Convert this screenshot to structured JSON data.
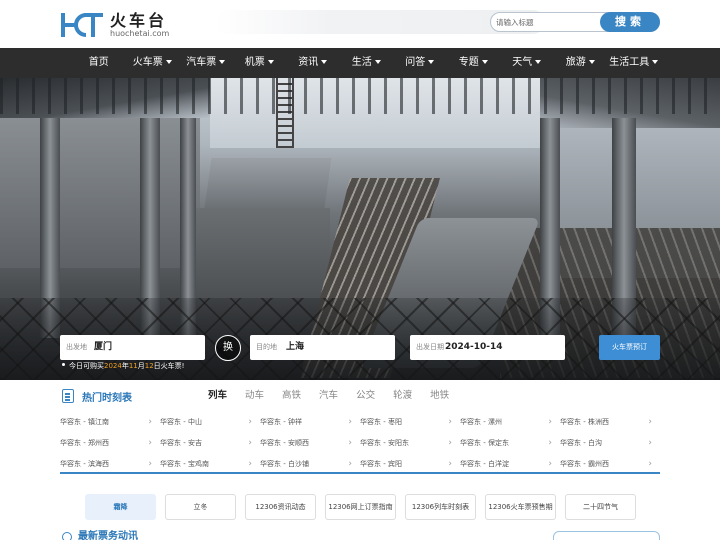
{
  "brand": {
    "logo_letters": "HCT",
    "name": "火车台",
    "domain": "huochetai.com",
    "accent": "#3a86c4"
  },
  "search": {
    "placeholder": "请输入标题",
    "button_label": "搜索"
  },
  "nav": {
    "items": [
      {
        "label": "首页",
        "dropdown": false
      },
      {
        "label": "火车票",
        "dropdown": true
      },
      {
        "label": "汽车票",
        "dropdown": true
      },
      {
        "label": "机票",
        "dropdown": true
      },
      {
        "label": "资讯",
        "dropdown": true
      },
      {
        "label": "生活",
        "dropdown": true
      },
      {
        "label": "问答",
        "dropdown": true
      },
      {
        "label": "专题",
        "dropdown": true
      },
      {
        "label": "天气",
        "dropdown": true
      },
      {
        "label": "旅游",
        "dropdown": true
      },
      {
        "label": "生活工具",
        "dropdown": true
      }
    ],
    "bg": "#2d2d2d"
  },
  "booking": {
    "from_label": "出发地",
    "from_value": "厦门",
    "swap_label": "换",
    "to_label": "目的地",
    "to_value": "上海",
    "date_label": "出发日期",
    "date_value": "2024-10-14",
    "submit_label": "火车票预订",
    "notice_prefix": "今日可购买",
    "notice_year": "2024",
    "notice_year_unit": "年",
    "notice_month": "11",
    "notice_month_unit": "月",
    "notice_day": "12",
    "notice_suffix": "日火车票!"
  },
  "timetable": {
    "title": "热门时刻表",
    "tabs": [
      {
        "label": "列车",
        "active": true
      },
      {
        "label": "动车",
        "active": false
      },
      {
        "label": "高铁",
        "active": false
      },
      {
        "label": "汽车",
        "active": false
      },
      {
        "label": "公交",
        "active": false
      },
      {
        "label": "轮渡",
        "active": false
      },
      {
        "label": "地铁",
        "active": false
      }
    ],
    "arrow": "›",
    "rows": [
      [
        "华容东 - 镇江南",
        "华容东 - 中山",
        "华容东 - 钟祥",
        "华容东 - 枣阳",
        "华容东 - 漯州",
        "华容东 - 株洲西"
      ],
      [
        "华容东 - 郑州西",
        "华容东 - 安吉",
        "华容东 - 安顺西",
        "华容东 - 安阳东",
        "华容东 - 保定东",
        "华容东 - 白沟"
      ],
      [
        "华容东 - 滨海西",
        "华容东 - 宝鸡南",
        "华容东 - 白沙铺",
        "华容东 - 宾阳",
        "华容东 - 白洋淀",
        "华容东 - 霸州西"
      ]
    ]
  },
  "tags": [
    {
      "label": "霜降",
      "active": true
    },
    {
      "label": "立冬",
      "active": false
    },
    {
      "label": "12306资讯动态",
      "active": false
    },
    {
      "label": "12306网上订票指南",
      "active": false
    },
    {
      "label": "12306列车时刻表",
      "active": false
    },
    {
      "label": "12306火车票预售期",
      "active": false
    },
    {
      "label": "二十四节气",
      "active": false
    }
  ],
  "bottom": {
    "section_title": "最新票务动讯"
  }
}
